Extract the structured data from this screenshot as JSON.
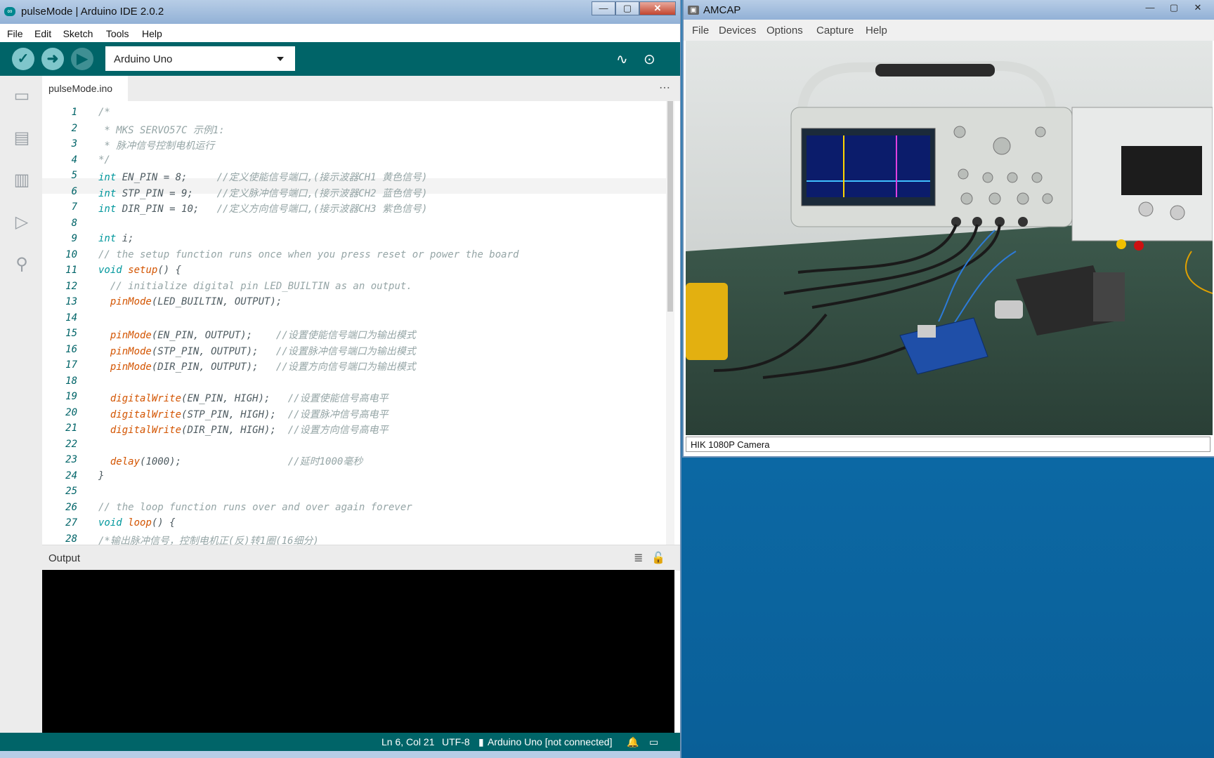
{
  "ide": {
    "title": "pulseMode | Arduino IDE 2.0.2",
    "menu": [
      "File",
      "Edit",
      "Sketch",
      "Tools",
      "Help"
    ],
    "board": "Arduino Uno",
    "tab": "pulseMode.ino",
    "output_label": "Output",
    "code": [
      {
        "n": "1",
        "t": "/*"
      },
      {
        "n": "2",
        "t": " * MKS SERVO57C 示例1:"
      },
      {
        "n": "3",
        "t": " * 脉冲信号控制电机运行"
      },
      {
        "n": "4",
        "t": "*/"
      },
      {
        "n": "5",
        "t": "int EN_PIN = 8;     //定义使能信号端口,(接示波器CH1 黄色信号)"
      },
      {
        "n": "6",
        "t": "int STP_PIN = 9;    //定义脉冲信号端口,(接示波器CH2 蓝色信号)"
      },
      {
        "n": "7",
        "t": "int DIR_PIN = 10;   //定义方向信号端口,(接示波器CH3 紫色信号)"
      },
      {
        "n": "8",
        "t": ""
      },
      {
        "n": "9",
        "t": "int i;"
      },
      {
        "n": "10",
        "t": "// the setup function runs once when you press reset or power the board"
      },
      {
        "n": "11",
        "t": "void setup() {"
      },
      {
        "n": "12",
        "t": "  // initialize digital pin LED_BUILTIN as an output."
      },
      {
        "n": "13",
        "t": "  pinMode(LED_BUILTIN, OUTPUT);"
      },
      {
        "n": "14",
        "t": ""
      },
      {
        "n": "15",
        "t": "  pinMode(EN_PIN, OUTPUT);    //设置使能信号端口为输出模式"
      },
      {
        "n": "16",
        "t": "  pinMode(STP_PIN, OUTPUT);   //设置脉冲信号端口为输出模式"
      },
      {
        "n": "17",
        "t": "  pinMode(DIR_PIN, OUTPUT);   //设置方向信号端口为输出模式"
      },
      {
        "n": "18",
        "t": ""
      },
      {
        "n": "19",
        "t": "  digitalWrite(EN_PIN, HIGH);   //设置使能信号高电平"
      },
      {
        "n": "20",
        "t": "  digitalWrite(STP_PIN, HIGH);  //设置脉冲信号高电平"
      },
      {
        "n": "21",
        "t": "  digitalWrite(DIR_PIN, HIGH);  //设置方向信号高电平"
      },
      {
        "n": "22",
        "t": ""
      },
      {
        "n": "23",
        "t": "  delay(1000);                  //延时1000毫秒"
      },
      {
        "n": "24",
        "t": "}"
      },
      {
        "n": "25",
        "t": ""
      },
      {
        "n": "26",
        "t": "// the loop function runs over and over again forever"
      },
      {
        "n": "27",
        "t": "void loop() {"
      },
      {
        "n": "28",
        "t": "/*输出脉冲信号，控制电机正(反)转1圈(16细分)"
      }
    ],
    "status": {
      "position": "Ln 6, Col 21",
      "encoding": "UTF-8",
      "board": "Arduino Uno [not connected]"
    }
  },
  "amcap": {
    "title": "AMCAP",
    "menu": [
      "File",
      "Devices",
      "Options",
      "Capture",
      "Help"
    ],
    "status": "HIK 1080P Camera"
  },
  "colors": {
    "teal": "#006468",
    "accent": "#00979c",
    "orange": "#d35400"
  }
}
